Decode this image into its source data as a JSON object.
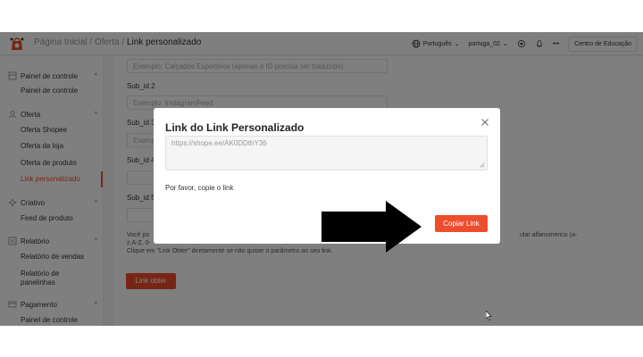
{
  "header": {
    "breadcrumb_home": "Página Inicial",
    "breadcrumb_sep1": " / ",
    "breadcrumb_offer": "Oferta",
    "breadcrumb_sep2": " / ",
    "breadcrumb_current": "Link personalizado",
    "language": "Português",
    "account": "portuga_02",
    "education_button": "Centro de Educação",
    "more": "•••"
  },
  "sidebar": {
    "groups": [
      {
        "title": "Painel de controle",
        "icon": "dashboard-icon",
        "items": [
          "Painel de controle"
        ]
      },
      {
        "title": "Oferta",
        "icon": "offer-icon",
        "items": [
          "Oferta Shopee",
          "Oferta da loja",
          "Oferta de produto",
          "Link personalizado"
        ]
      },
      {
        "title": "Criativo",
        "icon": "creative-icon",
        "items": [
          "Feed de produto"
        ]
      },
      {
        "title": "Relatório",
        "icon": "report-icon",
        "items": [
          "Relatório de vendas",
          "Relatório de panelinhas"
        ]
      },
      {
        "title": "Pagamento",
        "icon": "payment-icon",
        "items": [
          "Painel de controle"
        ]
      }
    ],
    "active_item": "Link personalizado"
  },
  "form": {
    "sub1_placeholder": "Exemplo: Calçados Esportivos (apenas o ID precisa ser traduzido)",
    "sub2_label": "Sub_id 2",
    "sub2_placeholder": "Exemplo: InstagramFeed",
    "sub3_label": "Sub_id 3",
    "sub3_placeholder": "Exemp",
    "sub4_label": "Sub_id 4",
    "sub5_label": "Sub_id 5",
    "help_line1_start": "Você po",
    "help_line1_end": "ular alfanumérico (a-",
    "help_line2": "z,A-Z, 0-",
    "help_line3": "Clique em \"Link Obter\" diretamente se não quiser o parâmetro ao seu link.",
    "get_link_button": "Link obter"
  },
  "modal": {
    "title": "Link do Link Personalizado",
    "link_value": "https://shope.ee/AK0DDthY36",
    "note": "Por favor, copie o link",
    "copy_button": "Copiar Link"
  },
  "colors": {
    "accent": "#ee4d2d",
    "overlay": "rgba(0,0,0,0.5)",
    "arrow": "#000000"
  }
}
